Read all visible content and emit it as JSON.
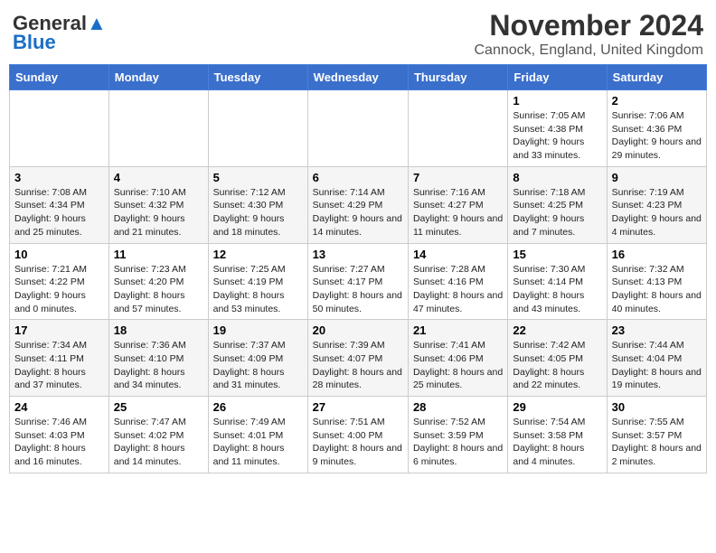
{
  "header": {
    "logo_line1": "General",
    "logo_line2": "Blue",
    "title": "November 2024",
    "subtitle": "Cannock, England, United Kingdom"
  },
  "weekdays": [
    "Sunday",
    "Monday",
    "Tuesday",
    "Wednesday",
    "Thursday",
    "Friday",
    "Saturday"
  ],
  "weeks": [
    [
      {
        "day": "",
        "info": ""
      },
      {
        "day": "",
        "info": ""
      },
      {
        "day": "",
        "info": ""
      },
      {
        "day": "",
        "info": ""
      },
      {
        "day": "",
        "info": ""
      },
      {
        "day": "1",
        "info": "Sunrise: 7:05 AM\nSunset: 4:38 PM\nDaylight: 9 hours and 33 minutes."
      },
      {
        "day": "2",
        "info": "Sunrise: 7:06 AM\nSunset: 4:36 PM\nDaylight: 9 hours and 29 minutes."
      }
    ],
    [
      {
        "day": "3",
        "info": "Sunrise: 7:08 AM\nSunset: 4:34 PM\nDaylight: 9 hours and 25 minutes."
      },
      {
        "day": "4",
        "info": "Sunrise: 7:10 AM\nSunset: 4:32 PM\nDaylight: 9 hours and 21 minutes."
      },
      {
        "day": "5",
        "info": "Sunrise: 7:12 AM\nSunset: 4:30 PM\nDaylight: 9 hours and 18 minutes."
      },
      {
        "day": "6",
        "info": "Sunrise: 7:14 AM\nSunset: 4:29 PM\nDaylight: 9 hours and 14 minutes."
      },
      {
        "day": "7",
        "info": "Sunrise: 7:16 AM\nSunset: 4:27 PM\nDaylight: 9 hours and 11 minutes."
      },
      {
        "day": "8",
        "info": "Sunrise: 7:18 AM\nSunset: 4:25 PM\nDaylight: 9 hours and 7 minutes."
      },
      {
        "day": "9",
        "info": "Sunrise: 7:19 AM\nSunset: 4:23 PM\nDaylight: 9 hours and 4 minutes."
      }
    ],
    [
      {
        "day": "10",
        "info": "Sunrise: 7:21 AM\nSunset: 4:22 PM\nDaylight: 9 hours and 0 minutes."
      },
      {
        "day": "11",
        "info": "Sunrise: 7:23 AM\nSunset: 4:20 PM\nDaylight: 8 hours and 57 minutes."
      },
      {
        "day": "12",
        "info": "Sunrise: 7:25 AM\nSunset: 4:19 PM\nDaylight: 8 hours and 53 minutes."
      },
      {
        "day": "13",
        "info": "Sunrise: 7:27 AM\nSunset: 4:17 PM\nDaylight: 8 hours and 50 minutes."
      },
      {
        "day": "14",
        "info": "Sunrise: 7:28 AM\nSunset: 4:16 PM\nDaylight: 8 hours and 47 minutes."
      },
      {
        "day": "15",
        "info": "Sunrise: 7:30 AM\nSunset: 4:14 PM\nDaylight: 8 hours and 43 minutes."
      },
      {
        "day": "16",
        "info": "Sunrise: 7:32 AM\nSunset: 4:13 PM\nDaylight: 8 hours and 40 minutes."
      }
    ],
    [
      {
        "day": "17",
        "info": "Sunrise: 7:34 AM\nSunset: 4:11 PM\nDaylight: 8 hours and 37 minutes."
      },
      {
        "day": "18",
        "info": "Sunrise: 7:36 AM\nSunset: 4:10 PM\nDaylight: 8 hours and 34 minutes."
      },
      {
        "day": "19",
        "info": "Sunrise: 7:37 AM\nSunset: 4:09 PM\nDaylight: 8 hours and 31 minutes."
      },
      {
        "day": "20",
        "info": "Sunrise: 7:39 AM\nSunset: 4:07 PM\nDaylight: 8 hours and 28 minutes."
      },
      {
        "day": "21",
        "info": "Sunrise: 7:41 AM\nSunset: 4:06 PM\nDaylight: 8 hours and 25 minutes."
      },
      {
        "day": "22",
        "info": "Sunrise: 7:42 AM\nSunset: 4:05 PM\nDaylight: 8 hours and 22 minutes."
      },
      {
        "day": "23",
        "info": "Sunrise: 7:44 AM\nSunset: 4:04 PM\nDaylight: 8 hours and 19 minutes."
      }
    ],
    [
      {
        "day": "24",
        "info": "Sunrise: 7:46 AM\nSunset: 4:03 PM\nDaylight: 8 hours and 16 minutes."
      },
      {
        "day": "25",
        "info": "Sunrise: 7:47 AM\nSunset: 4:02 PM\nDaylight: 8 hours and 14 minutes."
      },
      {
        "day": "26",
        "info": "Sunrise: 7:49 AM\nSunset: 4:01 PM\nDaylight: 8 hours and 11 minutes."
      },
      {
        "day": "27",
        "info": "Sunrise: 7:51 AM\nSunset: 4:00 PM\nDaylight: 8 hours and 9 minutes."
      },
      {
        "day": "28",
        "info": "Sunrise: 7:52 AM\nSunset: 3:59 PM\nDaylight: 8 hours and 6 minutes."
      },
      {
        "day": "29",
        "info": "Sunrise: 7:54 AM\nSunset: 3:58 PM\nDaylight: 8 hours and 4 minutes."
      },
      {
        "day": "30",
        "info": "Sunrise: 7:55 AM\nSunset: 3:57 PM\nDaylight: 8 hours and 2 minutes."
      }
    ]
  ]
}
